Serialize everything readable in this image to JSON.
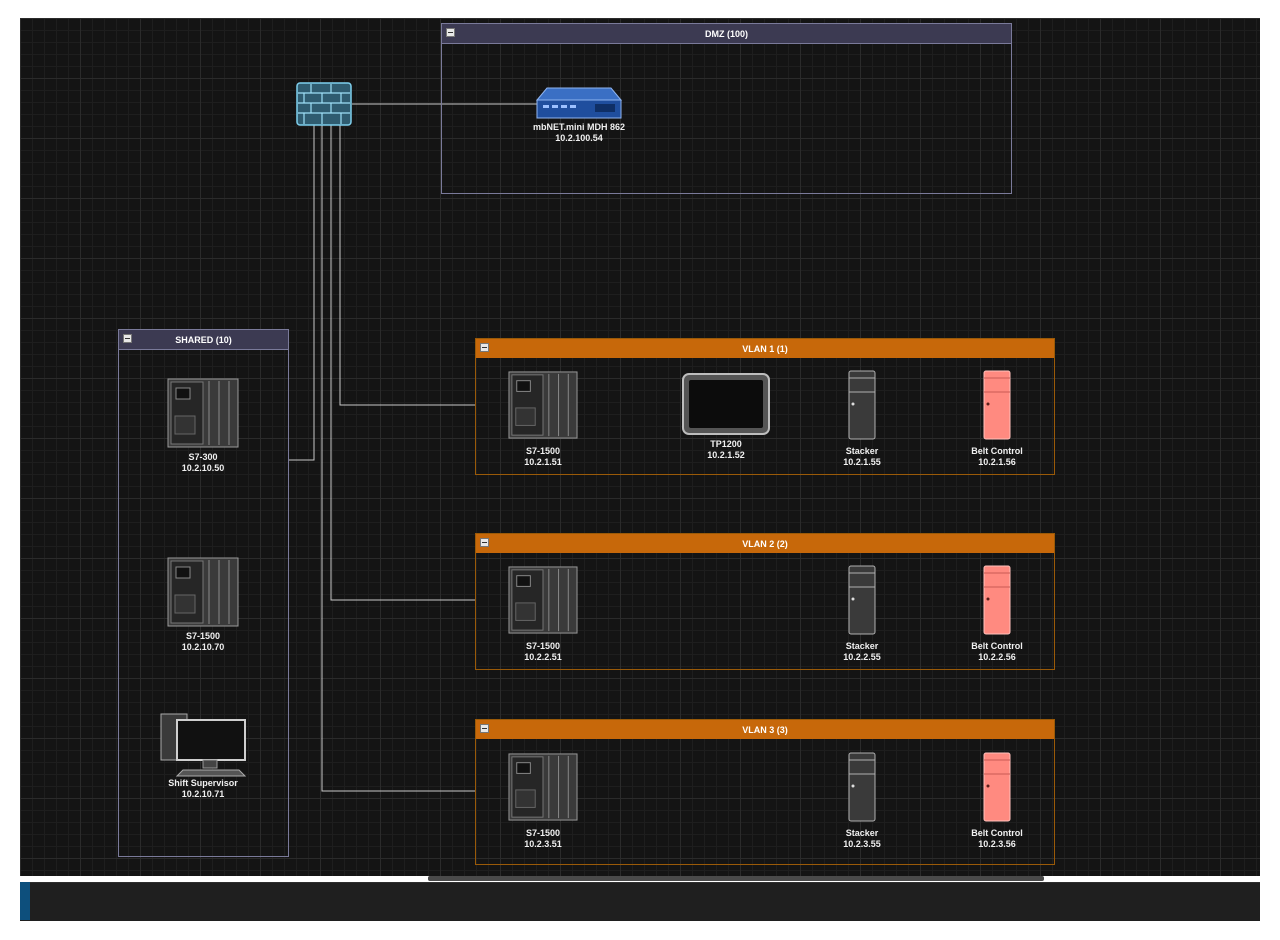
{
  "zones": {
    "dmz": {
      "title": "DMZ (100)"
    },
    "shared": {
      "title": "SHARED (10)"
    },
    "vlan1": {
      "title": "VLAN 1 (1)"
    },
    "vlan2": {
      "title": "VLAN 2 (2)"
    },
    "vlan3": {
      "title": "VLAN 3 (3)"
    }
  },
  "devices": {
    "firewall": {
      "icon": "firewall-icon"
    },
    "mbnet": {
      "name": "mbNET.mini MDH 862",
      "ip": "10.2.100.54",
      "icon": "router-icon"
    },
    "shared_s7_300": {
      "name": "S7-300",
      "ip": "10.2.10.50",
      "icon": "plc-rack-icon"
    },
    "shared_s7_1500": {
      "name": "S7-1500",
      "ip": "10.2.10.70",
      "icon": "plc-rack-icon"
    },
    "shift_supervisor": {
      "name": "Shift Supervisor",
      "ip": "10.2.10.71",
      "icon": "workstation-icon"
    },
    "v1_s7_1500": {
      "name": "S7-1500",
      "ip": "10.2.1.51",
      "icon": "plc-rack-icon"
    },
    "v1_tp1200": {
      "name": "TP1200",
      "ip": "10.2.1.52",
      "icon": "hmi-panel-icon"
    },
    "v1_stacker": {
      "name": "Stacker",
      "ip": "10.2.1.55",
      "icon": "controller-cabinet-icon"
    },
    "v1_belt": {
      "name": "Belt Control",
      "ip": "10.2.1.56",
      "icon": "controller-cabinet-alert-icon"
    },
    "v2_s7_1500": {
      "name": "S7-1500",
      "ip": "10.2.2.51",
      "icon": "plc-rack-icon"
    },
    "v2_stacker": {
      "name": "Stacker",
      "ip": "10.2.2.55",
      "icon": "controller-cabinet-icon"
    },
    "v2_belt": {
      "name": "Belt Control",
      "ip": "10.2.2.56",
      "icon": "controller-cabinet-alert-icon"
    },
    "v3_s7_1500": {
      "name": "S7-1500",
      "ip": "10.2.3.51",
      "icon": "plc-rack-icon"
    },
    "v3_stacker": {
      "name": "Stacker",
      "ip": "10.2.3.55",
      "icon": "controller-cabinet-icon"
    },
    "v3_belt": {
      "name": "Belt Control",
      "ip": "10.2.3.56",
      "icon": "controller-cabinet-alert-icon"
    }
  },
  "colors": {
    "canvas_bg": "#141414",
    "zone_grey_header": "#3c3a52",
    "zone_orange_header": "#c7680a",
    "link": "#c8c8c8",
    "alert_device": "#ff8a80",
    "firewall": "#5ab4d6"
  }
}
